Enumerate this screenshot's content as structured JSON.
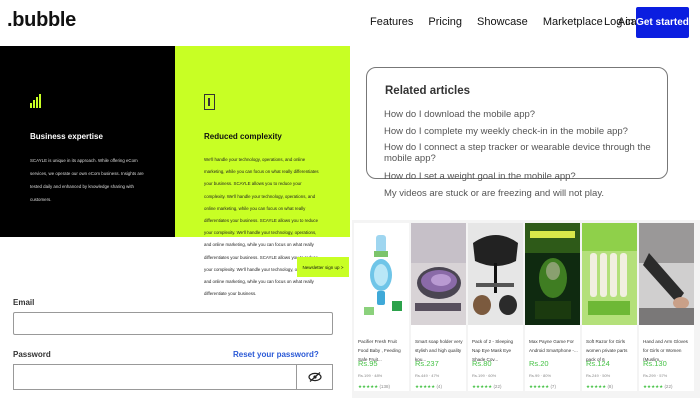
{
  "header": {
    "logo": ".bubble",
    "nav": [
      "Features",
      "Pricing",
      "Showcase",
      "Marketplace",
      "Academy"
    ],
    "login": "Log in",
    "cta": "Get started",
    "cta_color": "#0b1ee0"
  },
  "features": {
    "business": {
      "title": "Business expertise",
      "text": "SCAYLE is unique in its approach. While offering eCom services, we operate our own eCom business. Insights are tested daily and enhanced by knowledge sharing with customers.",
      "icon": "bar-chart-icon"
    },
    "complexity": {
      "title": "Reduced complexity",
      "text": "We'll handle your technology, operations, and online marketing, while you can focus on what really differentiates your business. SCAYLE allows you to reduce your complexity. We'll handle your technology, operations, and online marketing, while you can focus on what really differentiates your business. SCAYLE allows you to reduce your complexity. We'll handle your technology, operations, and online marketing, while you can focus on what really differentiates your business. SCAYLE allows you to reduce your complexity. We'll handle your technology, operations, and online marketing, while you can focus on what really differentiate your business.",
      "icon": "document-icon"
    },
    "newsletter": "Newsletter sign up >",
    "accent_color": "#c8ff24"
  },
  "related": {
    "title": "Related articles",
    "links": [
      "How do I download the mobile app?",
      "How do I complete my weekly check-in in the mobile app?",
      "How do I connect a step tracker or wearable device through the mobile app?",
      "How do I set a weight goal in the mobile app?",
      "My videos are stuck or are freezing and will not play."
    ]
  },
  "products": [
    {
      "title": "Pacifier Fresh Fruit Food Baby , Feeding Safe Fruit...",
      "price": "Rs.95",
      "mrp": "Rs.199 · 48%",
      "rating": "★★★★★",
      "count": "(138)"
    },
    {
      "title": "Smart soap holder very stylish and high quality kou...",
      "price": "Rs.237",
      "mrp": "Rs.449 · 47%",
      "rating": "★★★★★",
      "count": "(4)"
    },
    {
      "title": "Pack of 2 - Sleeping Nap Eye Mask Eye Shade Cov...",
      "price": "Rs.80",
      "mrp": "Rs.199 · 60%",
      "rating": "★★★★★",
      "count": "(22)"
    },
    {
      "title": "Max Payne Game For Android Smartphone -...",
      "price": "Rs.20",
      "mrp": "Rs.99 · 80%",
      "rating": "★★★★★",
      "count": "(7)"
    },
    {
      "title": "Soft Razor for Girls women private parts pack of 6",
      "price": "Rs.124",
      "mrp": "Rs.249 · 50%",
      "rating": "★★★★★",
      "count": "(8)"
    },
    {
      "title": "Hand and Arm Gloves for Girls or Women (Muslim...",
      "price": "Rs.130",
      "mrp": "Rs.299 · 57%",
      "rating": "★★★★★",
      "count": "(22)"
    }
  ],
  "form": {
    "email_label": "Email",
    "email_value": "",
    "password_label": "Password",
    "password_value": "",
    "reset_link": "Reset your password?",
    "eye_icon": "eye-slash-icon"
  }
}
